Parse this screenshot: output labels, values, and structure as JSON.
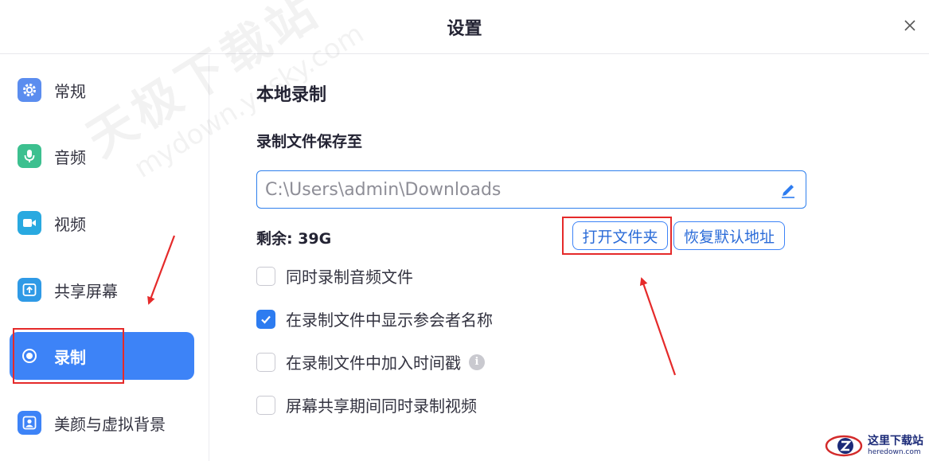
{
  "window": {
    "title": "设置"
  },
  "sidebar": {
    "items": [
      {
        "label": "常规",
        "icon": "gear-icon",
        "color": "#5b8def",
        "active": false
      },
      {
        "label": "音频",
        "icon": "microphone-icon",
        "color": "#3cc08f",
        "active": false
      },
      {
        "label": "视频",
        "icon": "video-camera-icon",
        "color": "#29a9e0",
        "active": false
      },
      {
        "label": "共享屏幕",
        "icon": "share-screen-icon",
        "color": "#2f9ae6",
        "active": false
      },
      {
        "label": "录制",
        "icon": "record-icon",
        "color": "#3d83f7",
        "active": true
      },
      {
        "label": "美颜与虚拟背景",
        "icon": "person-portrait-icon",
        "color": "#3d83f7",
        "active": false
      }
    ]
  },
  "main": {
    "section_title": "本地录制",
    "save_to_label": "录制文件保存至",
    "path_value": "C:\\Users\\admin\\Downloads",
    "remaining": "剩余: 39G",
    "open_folder_button": "打开文件夹",
    "restore_default_button": "恢复默认地址",
    "options": [
      {
        "label": "同时录制音频文件",
        "checked": false
      },
      {
        "label": "在录制文件中显示参会者名称",
        "checked": true
      },
      {
        "label": "在录制文件中加入时间戳",
        "checked": false,
        "info": "i"
      },
      {
        "label": "屏幕共享期间同时录制视频",
        "checked": false
      }
    ]
  },
  "watermark": {
    "line1": "天极下载站",
    "line2": "mydown.yesky.com"
  },
  "corner_logo": {
    "cn": "这里下载站",
    "en": "heredown.com"
  },
  "colors": {
    "accent": "#3d83f7",
    "annotation": "#e52a2a"
  }
}
